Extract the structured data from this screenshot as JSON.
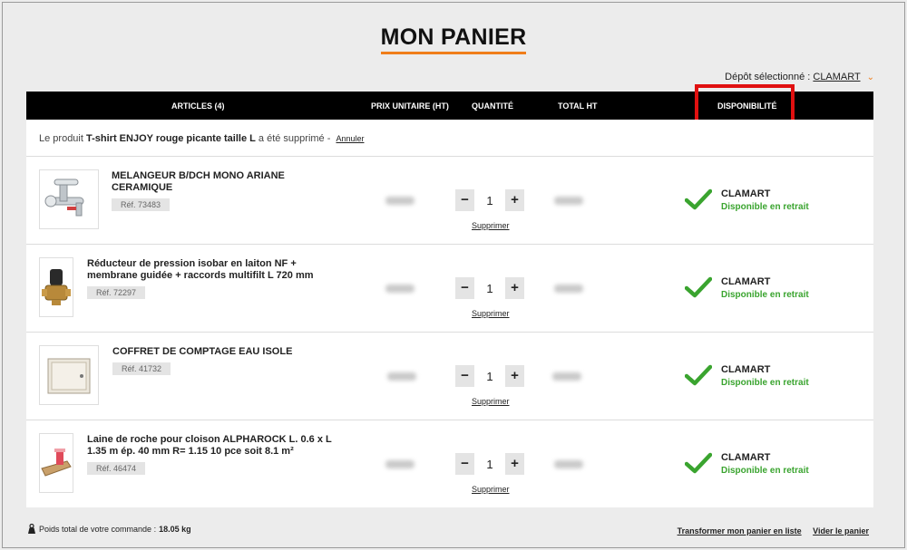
{
  "page": {
    "title": "MON PANIER"
  },
  "depot": {
    "label": "Dépôt sélectionné :",
    "name": "CLAMART"
  },
  "table_header": {
    "articles": "ARTICLES (4)",
    "prix": "PRIX UNITAIRE (HT)",
    "quantite": "QUANTITÉ",
    "total": "TOTAL HT",
    "disponibilite": "DISPONIBILITÉ"
  },
  "removed_notice": {
    "prefix": "Le produit",
    "product": "T-shirt ENJOY rouge picante taille L",
    "suffix": "a été supprimé -",
    "undo": "Annuler"
  },
  "items": [
    {
      "name_line1": "MELANGEUR B/DCH MONO ARIANE",
      "name_line2": "CERAMIQUE",
      "ref": "Réf. 73483",
      "qty": "1",
      "remove": "Supprimer",
      "store": "CLAMART",
      "availability": "Disponible en retrait",
      "image": "mixer-tap-icon"
    },
    {
      "name_line1": "Réducteur de pression isobar en laiton NF +",
      "name_line2": "membrane guidée + raccords multifilt L 720 mm",
      "ref": "Réf. 72297",
      "qty": "1",
      "remove": "Supprimer",
      "store": "CLAMART",
      "availability": "Disponible en retrait",
      "image": "pressure-reducer-icon"
    },
    {
      "name_line1": "COFFRET DE COMPTAGE EAU ISOLE",
      "name_line2": "",
      "ref": "Réf. 41732",
      "qty": "1",
      "remove": "Supprimer",
      "store": "CLAMART",
      "availability": "Disponible en retrait",
      "image": "meter-box-icon"
    },
    {
      "name_line1": "Laine de roche pour cloison ALPHAROCK L. 0.6 x L",
      "name_line2": "1.35 m ép. 40 mm R= 1.15 10 pce soit 8.1 m²",
      "ref": "Réf. 46474",
      "qty": "1",
      "remove": "Supprimer",
      "store": "CLAMART",
      "availability": "Disponible en retrait",
      "image": "rock-wool-icon"
    }
  ],
  "qty_minus": "−",
  "qty_plus": "+",
  "footer": {
    "weight_label": "Poids total de votre commande :",
    "weight_value": "18.05 kg",
    "transform_link": "Transformer mon panier en liste",
    "empty_link": "Vider le panier"
  },
  "colors": {
    "accent": "#f07d1a",
    "available": "#3aa42f",
    "highlight": "#e01010",
    "header_bg": "#000000"
  }
}
